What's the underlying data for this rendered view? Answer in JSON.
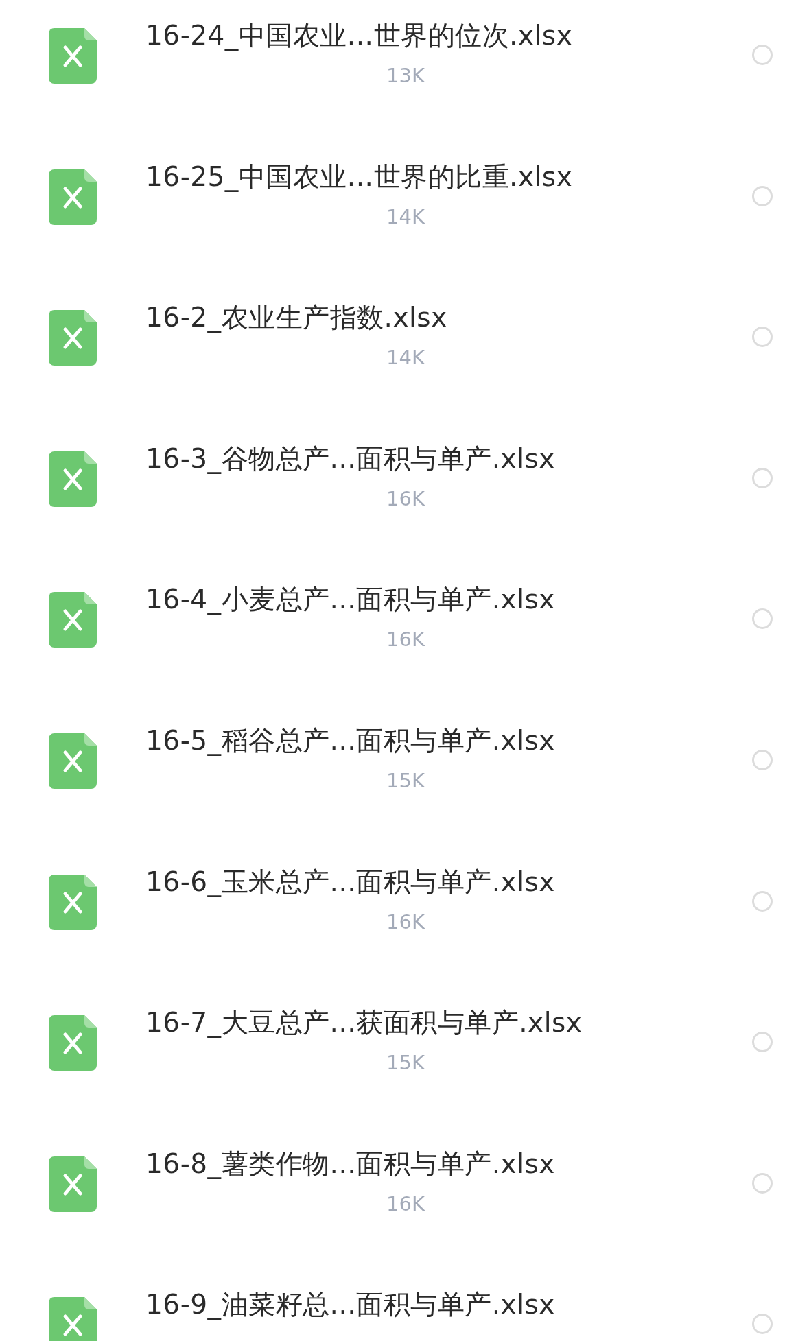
{
  "files": [
    {
      "name": "16-24_中国农业...世界的位次.xlsx",
      "size": "13K",
      "selected": false
    },
    {
      "name": "16-25_中国农业...世界的比重.xlsx",
      "size": "14K",
      "selected": false
    },
    {
      "name": "16-2_农业生产指数.xlsx",
      "size": "14K",
      "selected": false
    },
    {
      "name": "16-3_谷物总产...面积与单产.xlsx",
      "size": "16K",
      "selected": false
    },
    {
      "name": "16-4_小麦总产...面积与单产.xlsx",
      "size": "16K",
      "selected": false
    },
    {
      "name": "16-5_稻谷总产...面积与单产.xlsx",
      "size": "15K",
      "selected": false
    },
    {
      "name": "16-6_玉米总产...面积与单产.xlsx",
      "size": "16K",
      "selected": false
    },
    {
      "name": "16-7_大豆总产...获面积与单产.xlsx",
      "size": "15K",
      "selected": false
    },
    {
      "name": "16-8_薯类作物...面积与单产.xlsx",
      "size": "16K",
      "selected": false
    },
    {
      "name": "16-9_油菜籽总...面积与单产.xlsx",
      "selected": false
    }
  ]
}
